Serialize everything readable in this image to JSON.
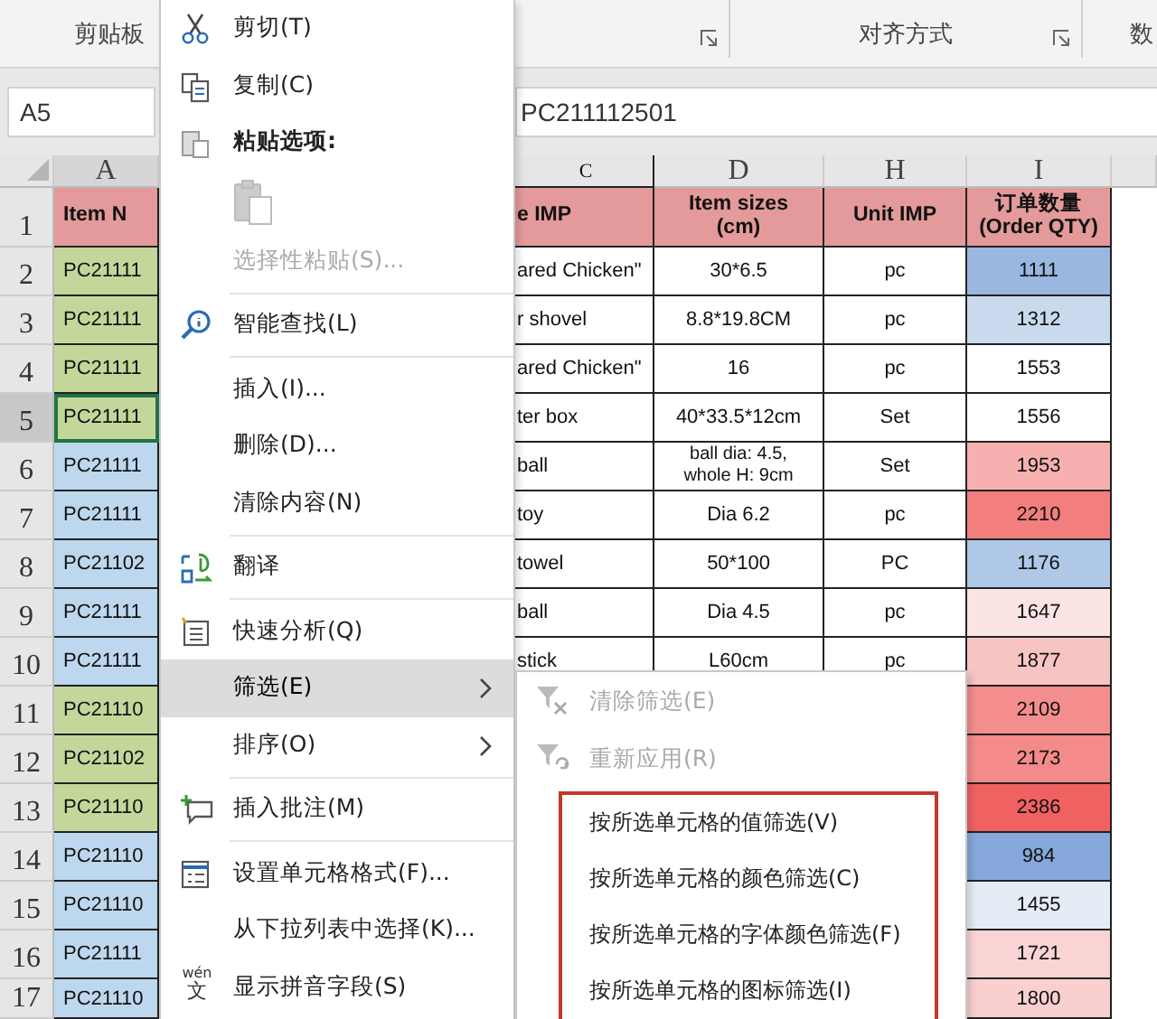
{
  "ribbon": {
    "groups": [
      {
        "label": "剪贴板"
      },
      {
        "launcher": true
      },
      {
        "label": "对齐方式",
        "launcher": true
      },
      {
        "label": "数"
      }
    ]
  },
  "name_box": "A5",
  "formula": "PC211112501",
  "sheet": {
    "columns": [
      "A",
      "C",
      "D",
      "H",
      "I"
    ],
    "rows": [
      {
        "num": "1",
        "kind": "header",
        "selected": false,
        "a": {
          "text": "Item N"
        },
        "c": {
          "text": "e IMP"
        },
        "d": {
          "text": "Item sizes\n(cm)"
        },
        "h": {
          "text": "Unit IMP"
        },
        "i": {
          "text": "订单数量\n(Order QTY)"
        }
      },
      {
        "num": "2",
        "kind": "data",
        "selected": false,
        "a": {
          "text": "PC21111",
          "color": "#c4d79b"
        },
        "c": {
          "text": "ared Chicken\""
        },
        "d": {
          "text": "30*6.5"
        },
        "h": {
          "text": "pc"
        },
        "i": {
          "text": "1111",
          "color": "#9ab7e0"
        }
      },
      {
        "num": "3",
        "kind": "data",
        "selected": false,
        "a": {
          "text": "PC21111",
          "color": "#c4d79b"
        },
        "c": {
          "text": "r shovel"
        },
        "d": {
          "text": "8.8*19.8CM"
        },
        "h": {
          "text": "pc"
        },
        "i": {
          "text": "1312",
          "color": "#c9d9ee"
        }
      },
      {
        "num": "4",
        "kind": "data",
        "selected": false,
        "a": {
          "text": "PC21111",
          "color": "#c4d79b"
        },
        "c": {
          "text": "ared Chicken\""
        },
        "d": {
          "text": "16"
        },
        "h": {
          "text": "pc"
        },
        "i": {
          "text": "1553",
          "color": "#ffffff"
        }
      },
      {
        "num": "5",
        "kind": "data",
        "selected": true,
        "a": {
          "text": "PC21111",
          "color": "#c4d79b"
        },
        "c": {
          "text": "ter box"
        },
        "d": {
          "text": "40*33.5*12cm"
        },
        "h": {
          "text": "Set"
        },
        "i": {
          "text": "1556",
          "color": "#ffffff"
        }
      },
      {
        "num": "6",
        "kind": "data",
        "selected": false,
        "a": {
          "text": "PC21111",
          "color": "#bdd7ee"
        },
        "c": {
          "text": "ball"
        },
        "d": {
          "text": "ball dia: 4.5,\nwhole H: 9cm"
        },
        "h": {
          "text": "Set"
        },
        "i": {
          "text": "1953",
          "color": "#f6b0b0"
        }
      },
      {
        "num": "7",
        "kind": "data",
        "selected": false,
        "a": {
          "text": "PC21111",
          "color": "#bdd7ee"
        },
        "c": {
          "text": "toy"
        },
        "d": {
          "text": "Dia 6.2"
        },
        "h": {
          "text": "pc"
        },
        "i": {
          "text": "2210",
          "color": "#f27e7e"
        }
      },
      {
        "num": "8",
        "kind": "data",
        "selected": false,
        "a": {
          "text": "PC21102",
          "color": "#bdd7ee"
        },
        "c": {
          "text": "towel"
        },
        "d": {
          "text": "50*100"
        },
        "h": {
          "text": "PC"
        },
        "i": {
          "text": "1176",
          "color": "#b0c8e8"
        }
      },
      {
        "num": "9",
        "kind": "data",
        "selected": false,
        "a": {
          "text": "PC21111",
          "color": "#bdd7ee"
        },
        "c": {
          "text": "ball"
        },
        "d": {
          "text": "Dia 4.5"
        },
        "h": {
          "text": "pc"
        },
        "i": {
          "text": "1647",
          "color": "#fbe4e4"
        }
      },
      {
        "num": "10",
        "kind": "data",
        "selected": false,
        "a": {
          "text": "PC21111",
          "color": "#bdd7ee"
        },
        "c": {
          "text": "stick"
        },
        "d": {
          "text": "L60cm"
        },
        "h": {
          "text": "pc"
        },
        "i": {
          "text": "1877",
          "color": "#f7c4c4"
        }
      },
      {
        "num": "11",
        "kind": "data",
        "selected": false,
        "a": {
          "text": "PC21110",
          "color": "#c4d79b"
        },
        "i": {
          "text": "2109",
          "color": "#f48e8e"
        }
      },
      {
        "num": "12",
        "kind": "data",
        "selected": false,
        "a": {
          "text": "PC21102",
          "color": "#c4d79b"
        },
        "i": {
          "text": "2173",
          "color": "#f48a8a"
        }
      },
      {
        "num": "13",
        "kind": "data",
        "selected": false,
        "a": {
          "text": "PC21110",
          "color": "#c4d79b"
        },
        "i": {
          "text": "2386",
          "color": "#f06262"
        }
      },
      {
        "num": "14",
        "kind": "data",
        "selected": false,
        "a": {
          "text": "PC21110",
          "color": "#bdd7ee"
        },
        "i": {
          "text": "984",
          "color": "#86a8da"
        }
      },
      {
        "num": "15",
        "kind": "data",
        "selected": false,
        "a": {
          "text": "PC21110",
          "color": "#bdd7ee"
        },
        "i": {
          "text": "1455",
          "color": "#e6ecf6"
        }
      },
      {
        "num": "16",
        "kind": "data",
        "selected": false,
        "a": {
          "text": "PC21111",
          "color": "#bdd7ee"
        },
        "i": {
          "text": "1721",
          "color": "#fad4d4"
        }
      },
      {
        "num": "17",
        "kind": "data",
        "selected": false,
        "a": {
          "text": "PC21110",
          "color": "#bdd7ee"
        },
        "i": {
          "text": "1800",
          "color": "#f9cfcf"
        }
      }
    ]
  },
  "menu": {
    "items": [
      {
        "kind": "scissors",
        "label": "剪切(T)",
        "disabled": false,
        "selected": false
      },
      {
        "kind": "copy",
        "label": "复制(C)",
        "disabled": false,
        "selected": false
      },
      {
        "kind": "pasteheader",
        "label": "粘贴选项:",
        "disabled": false,
        "selected": false
      },
      {
        "kind": "pastebutton",
        "disabled": true
      },
      {
        "kind": "plain",
        "label": "选择性粘贴(S)...",
        "disabled": true,
        "selected": false
      },
      {
        "kind": "separator"
      },
      {
        "kind": "lookup",
        "label": "智能查找(L)",
        "disabled": false,
        "selected": false
      },
      {
        "kind": "separator"
      },
      {
        "kind": "plain",
        "label": "插入(I)...",
        "disabled": false,
        "selected": false
      },
      {
        "kind": "plain",
        "label": "删除(D)...",
        "disabled": false,
        "selected": false
      },
      {
        "kind": "plain",
        "label": "清除内容(N)",
        "disabled": false,
        "selected": false
      },
      {
        "kind": "separator"
      },
      {
        "kind": "translate",
        "label": "翻译",
        "disabled": false,
        "selected": false
      },
      {
        "kind": "separator"
      },
      {
        "kind": "analysis",
        "label": "快速分析(Q)",
        "disabled": false,
        "selected": false
      },
      {
        "kind": "plain",
        "label": "筛选(E)",
        "disabled": false,
        "selected": true,
        "submenu": true
      },
      {
        "kind": "plain",
        "label": "排序(O)",
        "disabled": false,
        "selected": false,
        "submenu": true
      },
      {
        "kind": "separator"
      },
      {
        "kind": "comment",
        "label": "插入批注(M)",
        "disabled": false,
        "selected": false
      },
      {
        "kind": "separator"
      },
      {
        "kind": "format",
        "label": "设置单元格格式(F)...",
        "disabled": false,
        "selected": false
      },
      {
        "kind": "plain",
        "label": "从下拉列表中选择(K)...",
        "disabled": false,
        "selected": false
      },
      {
        "kind": "pinyin",
        "label": "显示拼音字段(S)",
        "icon_text": [
          "wén",
          "文"
        ],
        "disabled": false,
        "selected": false
      }
    ]
  },
  "submenu": {
    "items": [
      {
        "kind": "clearfilter",
        "label": "清除筛选(E)",
        "disabled": true
      },
      {
        "kind": "reapply",
        "label": "重新应用(R)",
        "disabled": true
      }
    ],
    "outlined_items": [
      "按所选单元格的值筛选(V)",
      "按所选单元格的颜色筛选(C)",
      "按所选单元格的字体颜色筛选(F)",
      "按所选单元格的图标筛选(I)"
    ]
  }
}
